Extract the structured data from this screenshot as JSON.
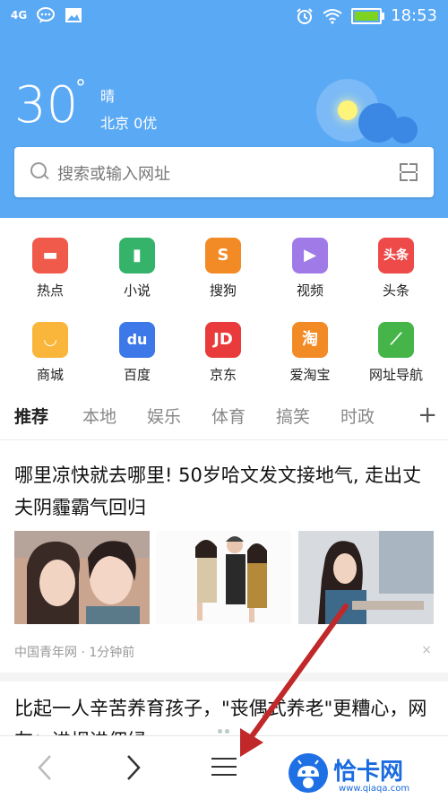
{
  "status_bar": {
    "signal": "4G",
    "time": "18:53"
  },
  "weather": {
    "temperature": "30",
    "degree": "°",
    "condition": "晴",
    "city_aqi": "北京 0优"
  },
  "search": {
    "placeholder": "搜索或输入网址"
  },
  "apps": [
    {
      "label": "热点",
      "glyph": "▬",
      "color": "#f05a4b"
    },
    {
      "label": "小说",
      "glyph": "▮",
      "color": "#36b36a"
    },
    {
      "label": "搜狗",
      "glyph": "S",
      "color": "#f28a25"
    },
    {
      "label": "视频",
      "glyph": "▶",
      "color": "#a07be8"
    },
    {
      "label": "头条",
      "glyph": "头条",
      "color": "#ee4a4a"
    },
    {
      "label": "商城",
      "glyph": "◡",
      "color": "#f9b63a"
    },
    {
      "label": "百度",
      "glyph": "du",
      "color": "#3d78e8"
    },
    {
      "label": "京东",
      "glyph": "JD",
      "color": "#e93b3b"
    },
    {
      "label": "爱淘宝",
      "glyph": "淘",
      "color": "#f28a25"
    },
    {
      "label": "网址导航",
      "glyph": "⟋",
      "color": "#45b54a"
    }
  ],
  "tabs": [
    "推荐",
    "本地",
    "娱乐",
    "体育",
    "搞笑",
    "时政"
  ],
  "tab_add": "+",
  "article1": {
    "title": "哪里凉快就去哪里! 50岁哈文发文接地气, 走出丈夫阴霾霸气回归",
    "source_time": "中国青年网 · 1分钟前",
    "close": "×"
  },
  "article2": {
    "title": "比起一人辛苦养育孩子，\"丧偶式养老\"更糟心，网友：进坝进佣绿"
  },
  "watermark": {
    "text": "恰卡网",
    "sub": "www.qiaqa.com"
  },
  "colors": {
    "header_bg": "#5aa9f4",
    "accent_arrow": "#c0282a"
  }
}
